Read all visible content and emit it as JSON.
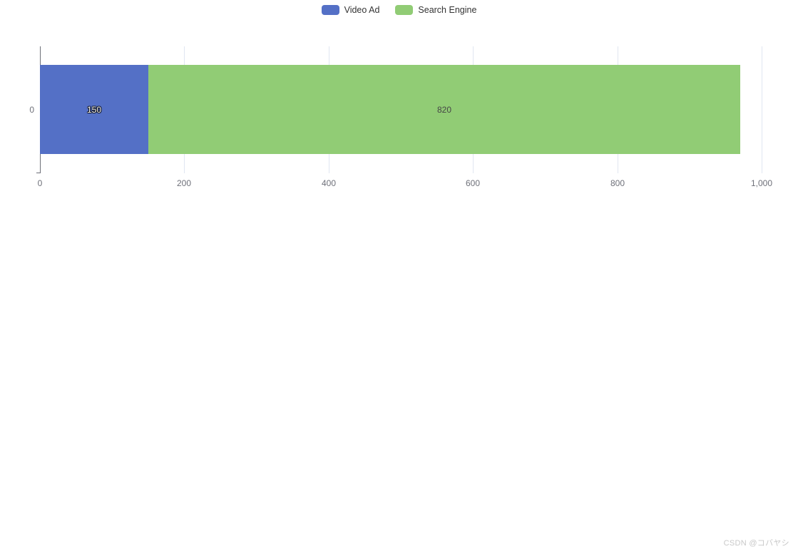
{
  "legend": {
    "position": "top-center",
    "items": [
      {
        "label": "Video Ad",
        "color": "#5470C6",
        "marker": "rounded-rect-marker"
      },
      {
        "label": "Search Engine",
        "color": "#91CC75",
        "marker": "rounded-rect-marker"
      }
    ]
  },
  "watermark": {
    "text": "CSDN @コバヤシ"
  },
  "chart_data": {
    "type": "bar",
    "orientation": "horizontal",
    "stacked": true,
    "title": "",
    "subtitle": "",
    "xlabel": "",
    "ylabel": "",
    "categories": [
      "0"
    ],
    "category_tick_labels": [
      "0"
    ],
    "series": [
      {
        "name": "Video Ad",
        "color": "#5470C6",
        "values": [
          150
        ],
        "data_labels": [
          "150"
        ],
        "label_color": "#ffffff"
      },
      {
        "name": "Search Engine",
        "color": "#91CC75",
        "values": [
          820
        ],
        "data_labels": [
          "820"
        ],
        "label_color": "#464646"
      }
    ],
    "stack_total": 970,
    "xlim": [
      0,
      1000
    ],
    "x_tick_values": [
      0,
      200,
      400,
      600,
      800,
      1000
    ],
    "x_tick_labels": [
      "0",
      "200",
      "400",
      "600",
      "800",
      "1,000"
    ],
    "grid": {
      "vertical": true,
      "horizontal": false,
      "color": "#E0E6F1"
    },
    "axis_line_color": "#6E7079",
    "tick_label_color": "#6E7079",
    "legend_position": "top"
  }
}
